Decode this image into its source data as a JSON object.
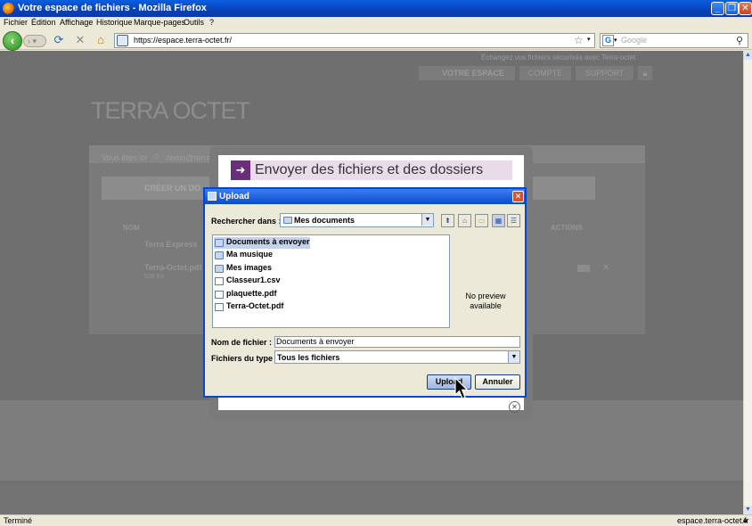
{
  "window": {
    "title": "Votre espace de fichiers - Mozilla Firefox"
  },
  "menu": [
    "Fichier",
    "Édition",
    "Affichage",
    "Historique",
    "Marque-pages",
    "Outils",
    "?"
  ],
  "nav": {
    "url": "https://espace.terra-octet.fr/",
    "search_placeholder": "Google"
  },
  "page": {
    "top_link": "Échangez vos fichiers sécurisés avec Terra-octet",
    "tabs": [
      "VOTRE ESPACE",
      "COMPTE",
      "SUPPORT"
    ],
    "logo": "TERRA OCTET",
    "breadcrumb_label": "Vous êtes ici",
    "breadcrumb_value": "demo@terra",
    "create_label": "CRÉER UN DO",
    "col_name": "NOM",
    "col_actions": "ACTIONS",
    "row1": "Terra Express",
    "row2": "Terra-Octet.pdf",
    "row2_sub": "526 Ko"
  },
  "modal": {
    "title": "Envoyer des fichiers et des dossiers"
  },
  "upload_dialog": {
    "title": "Upload",
    "look_in_label": "Rechercher dans :",
    "look_in_value": "Mes documents",
    "files": [
      {
        "name": "Documents à envoyer",
        "type": "folder",
        "selected": true
      },
      {
        "name": "Ma musique",
        "type": "folder",
        "selected": false
      },
      {
        "name": "Mes images",
        "type": "folder",
        "selected": false
      },
      {
        "name": "Classeur1.csv",
        "type": "file",
        "selected": false
      },
      {
        "name": "plaquette.pdf",
        "type": "file",
        "selected": false
      },
      {
        "name": "Terra-Octet.pdf",
        "type": "file",
        "selected": false
      }
    ],
    "preview_text": "No preview available",
    "filename_label": "Nom de fichier :",
    "filename_value": "Documents à envoyer",
    "filetype_label": "Fichiers du type :",
    "filetype_value": "Tous les fichiers",
    "upload_button": "Upload",
    "cancel_button": "Annuler"
  },
  "status": {
    "left": "Terminé",
    "right": "espace.terra-octet.fr"
  }
}
